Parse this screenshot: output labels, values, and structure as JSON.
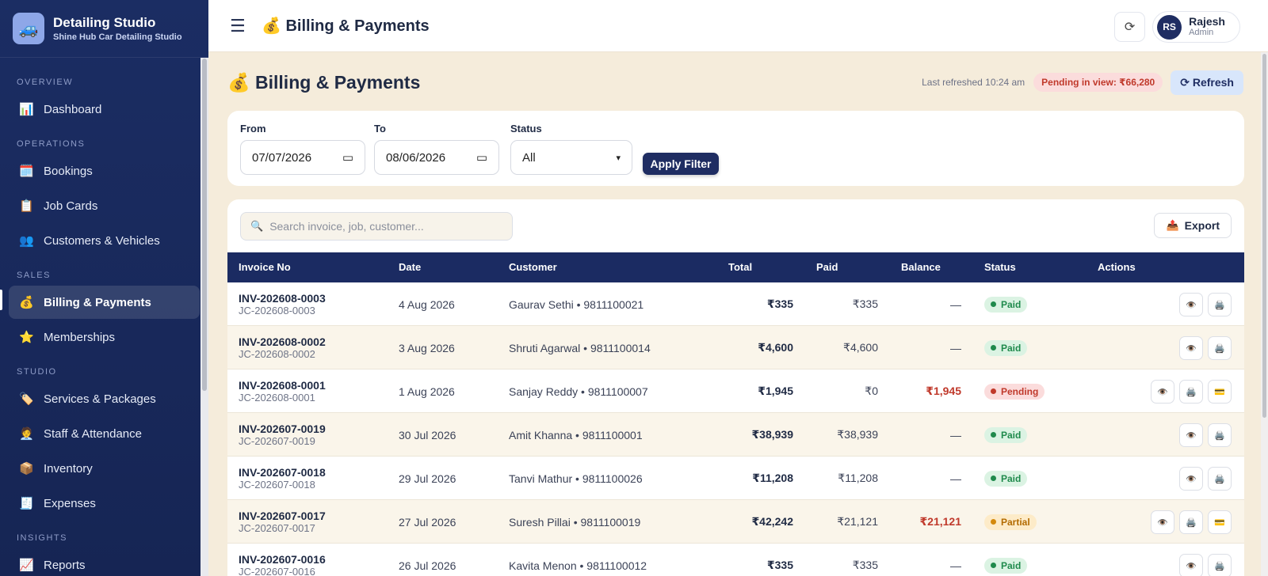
{
  "brand": {
    "logo": "🚙",
    "title": "Detailing Studio",
    "subtitle": "Shine Hub Car Detailing Studio"
  },
  "sidebar": {
    "sections": {
      "overview": "OVERVIEW",
      "operations": "OPERATIONS",
      "sales": "SALES",
      "studio": "STUDIO",
      "insights": "INSIGHTS"
    },
    "items": [
      {
        "label": "Dashboard",
        "icon": "📊"
      },
      {
        "label": "Bookings",
        "icon": "🗓️"
      },
      {
        "label": "Job Cards",
        "icon": "📋"
      },
      {
        "label": "Customers & Vehicles",
        "icon": "👥"
      },
      {
        "label": "Billing & Payments",
        "icon": "💰"
      },
      {
        "label": "Memberships",
        "icon": "⭐"
      },
      {
        "label": "Services & Packages",
        "icon": "🏷️"
      },
      {
        "label": "Staff & Attendance",
        "icon": "🧑‍💼"
      },
      {
        "label": "Inventory",
        "icon": "📦"
      },
      {
        "label": "Expenses",
        "icon": "🧾"
      },
      {
        "label": "Reports",
        "icon": "📈"
      }
    ]
  },
  "topbar": {
    "menu_icon": "☰",
    "title_icon": "💰",
    "title": "Billing & Payments",
    "refresh_icon": "⟳",
    "user": {
      "initials": "RS",
      "name": "Rajesh",
      "role": "Admin"
    }
  },
  "page": {
    "title_icon": "💰",
    "title": "Billing & Payments",
    "last_refreshed": "Last refreshed 10:24 am",
    "pending": "Pending in view: ₹66,280",
    "refresh_label": "⟳ Refresh"
  },
  "filters": {
    "from_label": "From",
    "from_value": "07/07/2026",
    "to_label": "To",
    "to_value": "08/06/2026",
    "status_label": "Status",
    "status_value": "All",
    "apply_label": "Apply Filter"
  },
  "table": {
    "search_placeholder": "Search invoice, job, customer...",
    "export_label": "Export",
    "headers": {
      "invoice": "Invoice No",
      "date": "Date",
      "customer": "Customer",
      "total": "Total",
      "paid": "Paid",
      "balance": "Balance",
      "status": "Status",
      "actions": "Actions"
    },
    "rows": [
      {
        "invoice": "INV-202608-0003",
        "job": "JC-202608-0003",
        "date": "4 Aug 2026",
        "customer": "Gaurav Sethi • 9811100021",
        "total": "₹335",
        "paid": "₹335",
        "balance": "—",
        "status": "Paid"
      },
      {
        "invoice": "INV-202608-0002",
        "job": "JC-202608-0002",
        "date": "3 Aug 2026",
        "customer": "Shruti Agarwal • 9811100014",
        "total": "₹4,600",
        "paid": "₹4,600",
        "balance": "—",
        "status": "Paid"
      },
      {
        "invoice": "INV-202608-0001",
        "job": "JC-202608-0001",
        "date": "1 Aug 2026",
        "customer": "Sanjay Reddy • 9811100007",
        "total": "₹1,945",
        "paid": "₹0",
        "balance": "₹1,945",
        "status": "Pending"
      },
      {
        "invoice": "INV-202607-0019",
        "job": "JC-202607-0019",
        "date": "30 Jul 2026",
        "customer": "Amit Khanna • 9811100001",
        "total": "₹38,939",
        "paid": "₹38,939",
        "balance": "—",
        "status": "Paid"
      },
      {
        "invoice": "INV-202607-0018",
        "job": "JC-202607-0018",
        "date": "29 Jul 2026",
        "customer": "Tanvi Mathur • 9811100026",
        "total": "₹11,208",
        "paid": "₹11,208",
        "balance": "—",
        "status": "Paid"
      },
      {
        "invoice": "INV-202607-0017",
        "job": "JC-202607-0017",
        "date": "27 Jul 2026",
        "customer": "Suresh Pillai • 9811100019",
        "total": "₹42,242",
        "paid": "₹21,121",
        "balance": "₹21,121",
        "status": "Partial"
      },
      {
        "invoice": "INV-202607-0016",
        "job": "JC-202607-0016",
        "date": "26 Jul 2026",
        "customer": "Kavita Menon • 9811100012",
        "total": "₹335",
        "paid": "₹335",
        "balance": "—",
        "status": "Paid"
      }
    ]
  },
  "colors": {
    "sidebar_bg": "#1b2d63",
    "table_header_bg": "#1b2b62",
    "page_bg": "#f5ecdb",
    "paid": "#1f8a4c",
    "pending": "#c0392b",
    "partial": "#b36b00"
  }
}
